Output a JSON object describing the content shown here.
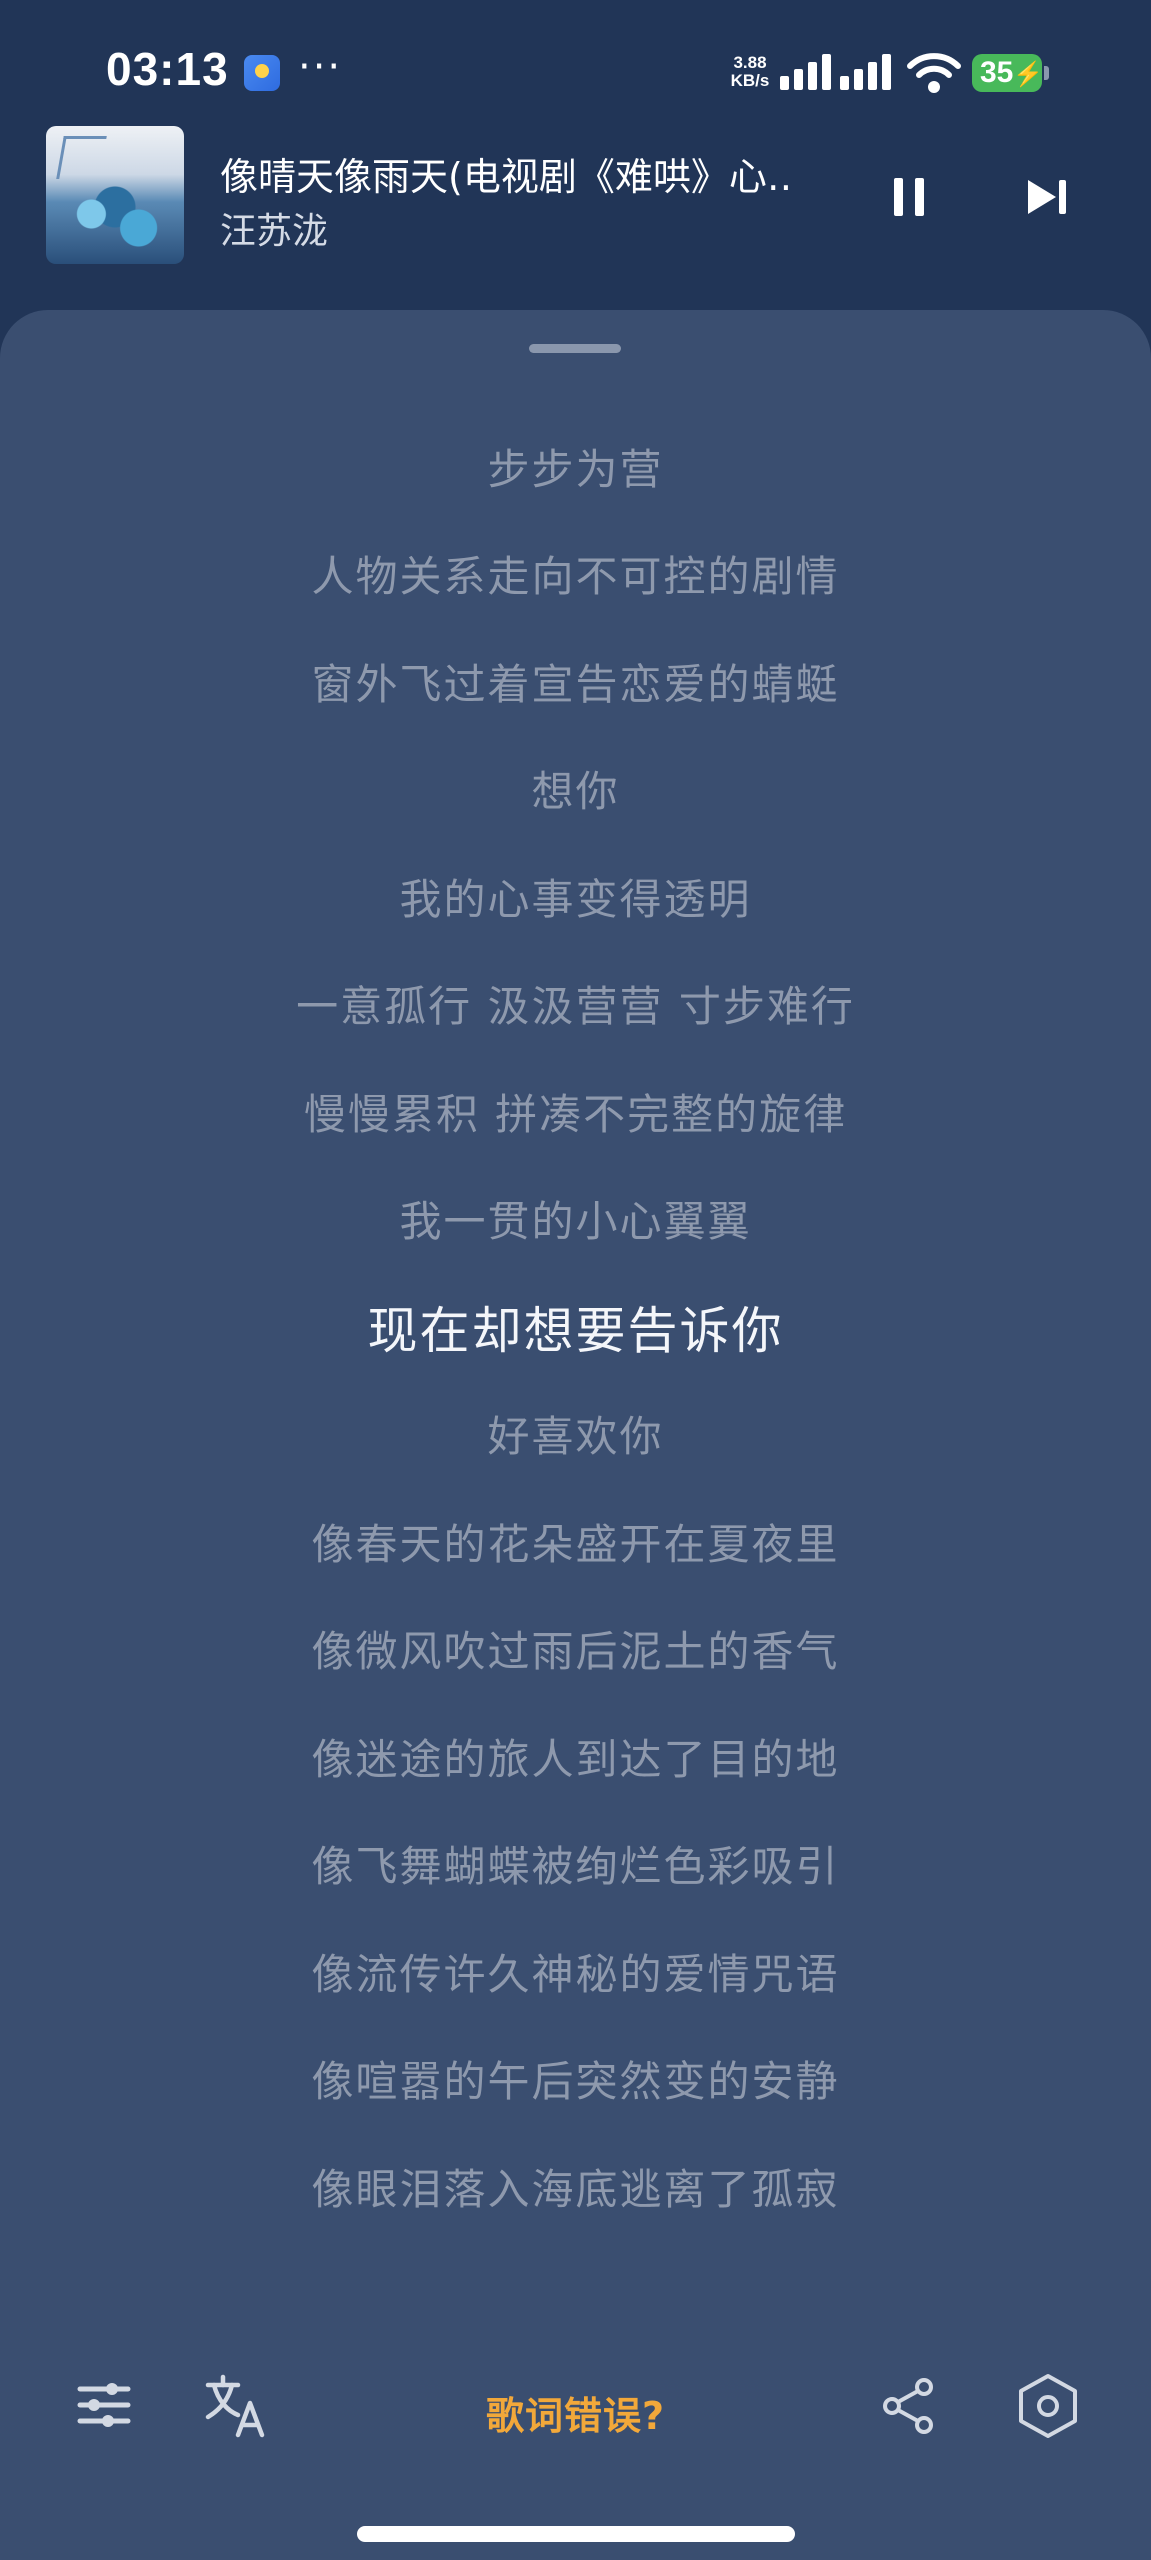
{
  "status_bar": {
    "time": "03:13",
    "net_speed_value": "3.88",
    "net_speed_unit": "KB/s",
    "battery": "35"
  },
  "now_playing": {
    "title": "像晴天像雨天(电视剧《难哄》心‥",
    "artist": "汪苏泷",
    "controls": [
      "pause-icon",
      "skip-next-icon"
    ]
  },
  "lyrics": {
    "lines": [
      "步步为营",
      "人物关系走向不可控的剧情",
      "窗外飞过着宣告恋爱的蜻蜓",
      "想你",
      "我的心事变得透明",
      "一意孤行 汲汲营营 寸步难行",
      "慢慢累积 拼凑不完整的旋律",
      "我一贯的小心翼翼",
      "现在却想要告诉你",
      "好喜欢你",
      "像春天的花朵盛开在夏夜里",
      "像微风吹过雨后泥土的香气",
      "像迷途的旅人到达了目的地",
      "像飞舞蝴蝶被绚烂色彩吸引",
      "像流传许久神秘的爱情咒语",
      "像喧嚣的午后突然变的安静",
      "像眼泪落入海底逃离了孤寂"
    ],
    "current_index": 8
  },
  "bottom_bar": {
    "error_link": "歌词错误?",
    "icons": [
      "equalizer-icon",
      "translate-icon",
      "share-icon",
      "settings-icon"
    ]
  },
  "colors": {
    "background": "#213557",
    "sheet": "#3a4e70",
    "lyric_inactive": "#8e99ad",
    "lyric_active": "#f4f6fa",
    "accent": "#f2a83a",
    "battery": "#48b95a"
  }
}
